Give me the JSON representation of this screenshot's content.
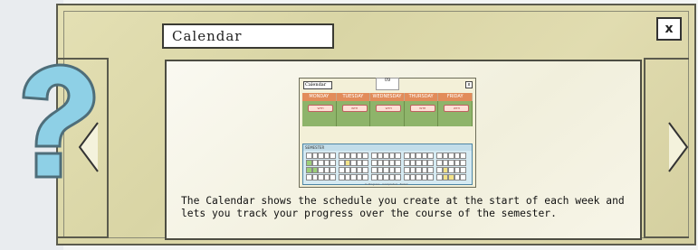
{
  "window": {
    "title": "Calendar",
    "close_label": "x"
  },
  "help": {
    "icon": "question-mark-icon",
    "description": "The Calendar shows the schedule you create at the start of each week and lets you track your progress over the course of the semester."
  },
  "navigation": {
    "prev_icon": "chevron-left-icon",
    "next_icon": "chevron-right-icon"
  },
  "preview": {
    "title": "Calendar",
    "close_label": "x",
    "date_number": "09",
    "days": [
      "MONDAY",
      "TUESDAY",
      "WEDNESDAY",
      "THURSDAY",
      "FRIDAY"
    ],
    "activity_label": "WTH",
    "semester_label": "SEMESTER",
    "legend": [
      "In Progress",
      "Completed",
      "Failed"
    ]
  },
  "colors": {
    "panel_bg": "#dcd8a8",
    "content_bg": "#f6f4e6",
    "day_header": "#e28c5a",
    "day_body": "#8eb46a",
    "semester_bg": "#d5eaf2",
    "question_icon": "#7ec4dd"
  }
}
